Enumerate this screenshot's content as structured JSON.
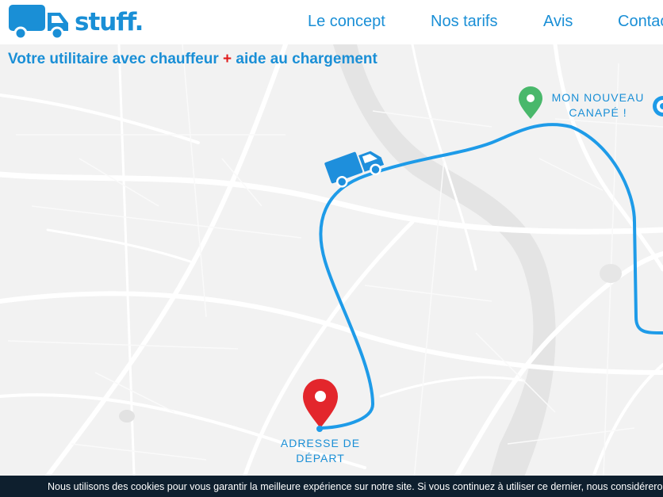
{
  "brand": {
    "name": "stuff."
  },
  "nav": {
    "items": [
      "Le concept",
      "Nos tarifs",
      "Avis",
      "Contact"
    ]
  },
  "hero": {
    "tagline_before": "Votre utilitaire avec chauffeur ",
    "tagline_plus": "+",
    "tagline_after": " aide au chargement"
  },
  "map": {
    "destination_line1": "MON NOUVEAU",
    "destination_line2": "CANAPÉ !",
    "origin_line1": "ADRESSE DE",
    "origin_line2": "DÉPART"
  },
  "cookie": {
    "text": "Nous utilisons des cookies pour vous garantir la meilleure expérience sur notre site. Si vous continuez à utiliser ce dernier, nous considérerons que vous acceptez l'utilisation des cookies."
  },
  "colors": {
    "brand": "#1a8fd6",
    "route": "#1e9be8",
    "origin_pin": "#e3262c",
    "destination_pin": "#49b86b",
    "plus": "#e01b1b",
    "cookie_bg": "#0e1f2e",
    "map_bg": "#f2f2f2"
  }
}
